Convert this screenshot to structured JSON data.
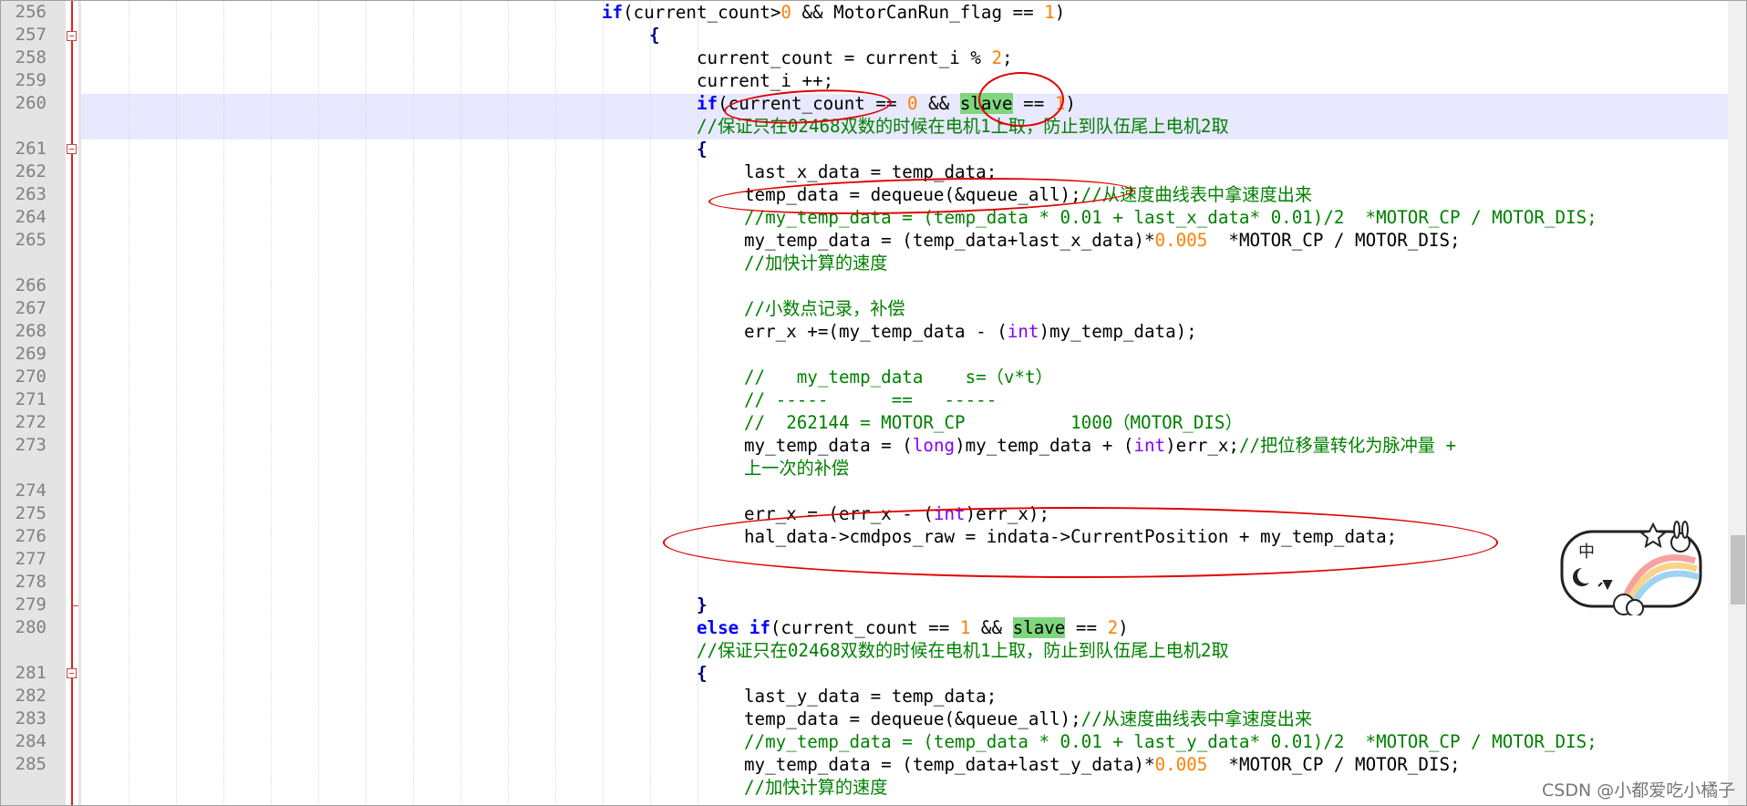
{
  "line_numbers": [
    "256",
    "257",
    "258",
    "259",
    "260",
    "261",
    "262",
    "263",
    "264",
    "265",
    "266",
    "267",
    "268",
    "269",
    "270",
    "271",
    "272",
    "273",
    "274",
    "275",
    "276",
    "277",
    "278",
    "279",
    "280",
    "281",
    "282",
    "283",
    "284",
    "285"
  ],
  "code": {
    "l256": {
      "if": "if",
      "open": "(current_count>",
      "zero": "0",
      "and": " && MotorCanRun_flag == ",
      "one": "1",
      "close": ")"
    },
    "l257": "{",
    "l258": {
      "a": "current_count = current_i % ",
      "two": "2",
      "b": ";"
    },
    "l259": "current_i ++;",
    "l260": {
      "if": "if",
      "a": "(current_count == ",
      "zero": "0",
      "b": " && ",
      "slave": "slave",
      "c": " == ",
      "one": "1",
      "d": ")"
    },
    "l260c": "//保证只在02468双数的时候在电机1上取，防止到队伍尾上电机2取",
    "l261": "{",
    "l262": "last_x_data = temp_data;",
    "l263": {
      "a": "temp_data = dequeue(&queue_all);",
      "c": "//从速度曲线表中拿速度出来"
    },
    "l264": "//my_temp_data = (temp_data * 0.01 + last_x_data* 0.01)/2  *MOTOR_CP / MOTOR_DIS;",
    "l265": {
      "a": "my_temp_data = (temp_data+last_x_data)*",
      "num": "0.005",
      "b": "  *MOTOR_CP / MOTOR_DIS;"
    },
    "l265c": "//加快计算的速度",
    "l267": "//小数点记录，补偿",
    "l268": {
      "a": "err_x +=(my_temp_data - (",
      "int": "int",
      "b": ")my_temp_data);"
    },
    "l270": "//   my_temp_data    s=（v*t）",
    "l271": "// -----      ==   -----",
    "l272": "//  262144 = MOTOR_CP          1000（MOTOR_DIS）",
    "l273": {
      "a": "my_temp_data = (",
      "long": "long",
      "b": ")my_temp_data + (",
      "int": "int",
      "c": ")err_x;",
      "cm": "//把位移量转化为脉冲量 +"
    },
    "l273c": "上一次的补偿",
    "l275": {
      "a": "err_x = (err_x - (",
      "int": "int",
      "b": ")err_x);"
    },
    "l276": "hal_data->cmdpos_raw = indata->CurrentPosition + my_temp_data;",
    "l279": "}",
    "l280": {
      "else": "else",
      "if": " if",
      "a": "(current_count == ",
      "one": "1",
      "b": " && ",
      "slave": "slave",
      "c": " == ",
      "two": "2",
      "d": ")"
    },
    "l280c": "//保证只在02468双数的时候在电机1上取，防止到队伍尾上电机2取",
    "l281": "{",
    "l282": "last_y_data = temp_data;",
    "l283": {
      "a": "temp_data = dequeue(&queue_all);",
      "c": "//从速度曲线表中拿速度出来"
    },
    "l284": "//my_temp_data = (temp_data * 0.01 + last_y_data* 0.01)/2  *MOTOR_CP / MOTOR_DIS;",
    "l285": {
      "a": "my_temp_data = (temp_data+last_y_data)*",
      "num": "0.005",
      "b": "  *MOTOR_CP / MOTOR_DIS;"
    },
    "l285c": "//加快计算的速度"
  },
  "sticker_text": "中",
  "watermark": "CSDN @小都爱吃小橘子"
}
